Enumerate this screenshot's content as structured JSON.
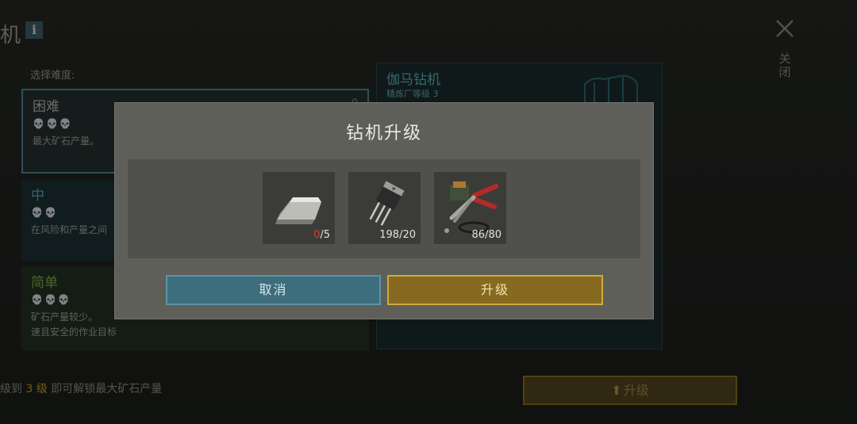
{
  "background": {
    "title": "机",
    "close_label": "关闭",
    "choose_label": "选择难度:",
    "difficulties": [
      {
        "name": "困难",
        "skulls": "💀💀💀",
        "desc": "最大矿石产量。"
      },
      {
        "name": "中",
        "skulls": "💀💀",
        "desc": "在风险和产量之间"
      },
      {
        "name": "简单",
        "skulls": "💀💀💀",
        "desc_1": "矿石产量较少。",
        "desc_2": "速且安全的作业目标"
      }
    ],
    "drill": {
      "name": "伽马钻机",
      "level": "精炼厂等级 3"
    },
    "unlock_hint": {
      "prefix": "级到",
      "level": "3 级",
      "suffix": "即可解锁最大矿石产量"
    },
    "upgrade_button": "升级"
  },
  "modal": {
    "title": "钻机升级",
    "items": [
      {
        "icon": "silver-ingot-icon",
        "have": "0",
        "need": "/5"
      },
      {
        "icon": "transistor-icon",
        "qty": "198/20"
      },
      {
        "icon": "pliers-icon",
        "qty": "86/80"
      }
    ],
    "cancel_label": "取消",
    "upgrade_label": "升级"
  },
  "colors": {
    "cancel": "#3d6e7e",
    "upgrade": "#876a1f",
    "insufficient": "#c9443a"
  }
}
